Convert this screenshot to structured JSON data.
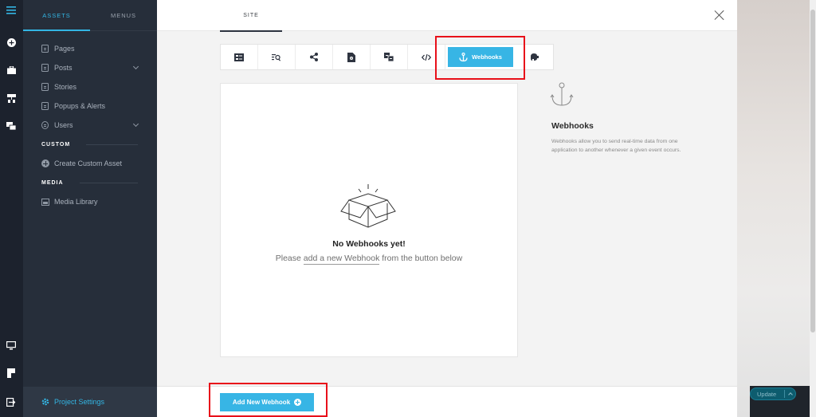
{
  "sidebar": {
    "tabs": [
      {
        "label": "ASSETS"
      },
      {
        "label": "MENUS"
      }
    ],
    "items": [
      {
        "label": "Pages"
      },
      {
        "label": "Posts"
      },
      {
        "label": "Stories"
      },
      {
        "label": "Popups & Alerts"
      },
      {
        "label": "Users"
      }
    ],
    "custom_section": "CUSTOM",
    "create_custom_asset": "Create Custom Asset",
    "media_section": "MEDIA",
    "media_library": "Media Library",
    "project_settings": "Project Settings"
  },
  "main": {
    "tab": "SITE",
    "toolbar_active_label": "Webhooks",
    "empty": {
      "title": "No Webhooks yet!",
      "sub_before": "Please ",
      "sub_link": "add a new Webhook",
      "sub_after": " from the button below"
    },
    "info": {
      "title": "Webhooks",
      "text": "Webhooks allow you to send real-time data from one application to another whenever a given event occurs."
    },
    "add_button": "Add New Webhook"
  },
  "right": {
    "update_label": "Update"
  },
  "colors": {
    "accent": "#37b5e5",
    "sidebar": "#262e3a",
    "highlight": "#e8101a"
  }
}
